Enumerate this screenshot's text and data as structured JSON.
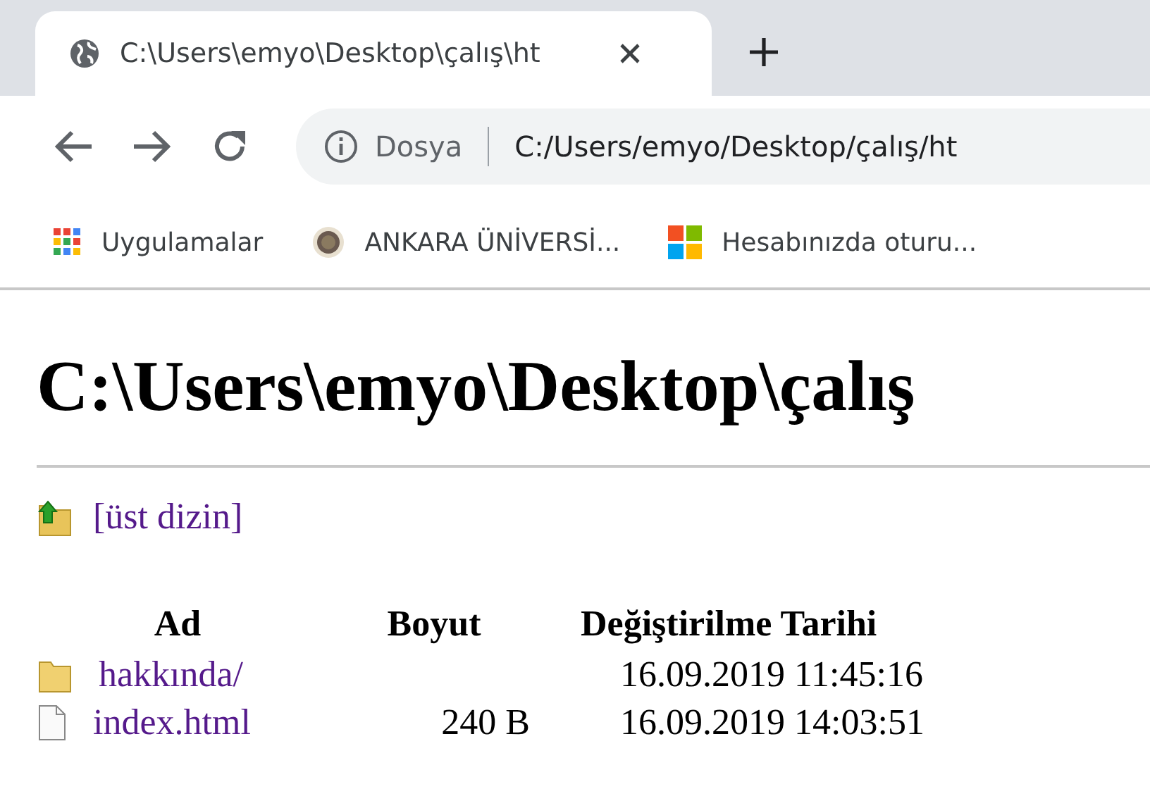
{
  "browser": {
    "tab": {
      "title": "C:\\Users\\emyo\\Desktop\\çalış\\ht",
      "selected": true
    },
    "address_bar": {
      "scheme_label": "Dosya",
      "url": "C:/Users/emyo/Desktop/çalış/ht"
    },
    "bookmarks": [
      {
        "kind": "apps",
        "label": "Uygulamalar"
      },
      {
        "kind": "seal",
        "label": "ANKARA ÜNİVERSİ..."
      },
      {
        "kind": "windows",
        "label": "Hesabınızda oturu..."
      }
    ]
  },
  "page": {
    "heading": "C:\\Users\\emyo\\Desktop\\çalış",
    "parent_link": "[üst dizin]",
    "table": {
      "columns": [
        "Ad",
        "Boyut",
        "Değiştirilme Tarihi"
      ],
      "rows": [
        {
          "kind": "folder",
          "name": "hakkında/",
          "size": "",
          "modified": "16.09.2019 11:45:16"
        },
        {
          "kind": "file",
          "name": "index.html",
          "size": "240 B",
          "modified": "16.09.2019 14:03:51"
        }
      ]
    }
  }
}
